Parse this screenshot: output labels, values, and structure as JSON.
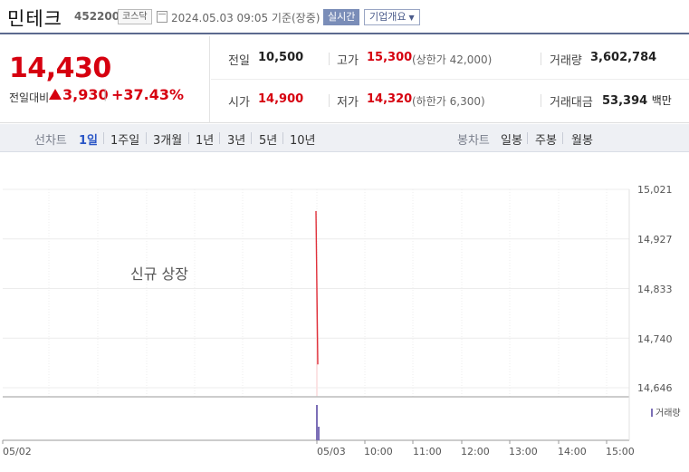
{
  "header": {
    "stock_name": "민테크",
    "stock_code": "452200",
    "market": "코스닥",
    "datetime": "2024.05.03 09:05 기준(장중)",
    "realtime_label": "실시간",
    "company_info_label": "기업개요"
  },
  "quote": {
    "price": "14,430",
    "change_label": "전일대비",
    "change_value": "3,930",
    "change_percent": "+37.43%",
    "prev_close_label": "전일",
    "prev_close": "10,500",
    "high_label": "고가",
    "high": "15,300",
    "upper_limit": "(상한가 42,000)",
    "volume_label": "거래량",
    "volume": "3,602,784",
    "open_label": "시가",
    "open": "14,900",
    "low_label": "저가",
    "low": "14,320",
    "lower_limit": "(하한가 6,300)",
    "value_label": "거래대금",
    "value": "53,394",
    "value_unit": "백만"
  },
  "toolbar": {
    "line_chart_label": "선차트",
    "periods": [
      "1일",
      "1주일",
      "3개월",
      "1년",
      "3년",
      "5년",
      "10년"
    ],
    "candle_chart_label": "봉차트",
    "candles": [
      "일봉",
      "주봉",
      "월봉"
    ],
    "selected_period": "1일"
  },
  "chart_data": {
    "type": "line",
    "annotation": "신규 상장",
    "y_ticks": [
      "15,021",
      "14,927",
      "14,833",
      "14,740",
      "14,646"
    ],
    "x_ticks": [
      "05/02",
      "05/03",
      "10:00",
      "11:00",
      "12:00",
      "13:00",
      "14:00",
      "15:00"
    ],
    "ylim": [
      14646,
      15021
    ],
    "series": [
      {
        "x": [
          "09:00",
          "09:05"
        ],
        "values": [
          14980,
          14690
        ]
      }
    ],
    "volume_label": "거래량",
    "colors": {
      "price_line": "#e0323c",
      "volume_bar": "#7c6fb7"
    }
  }
}
